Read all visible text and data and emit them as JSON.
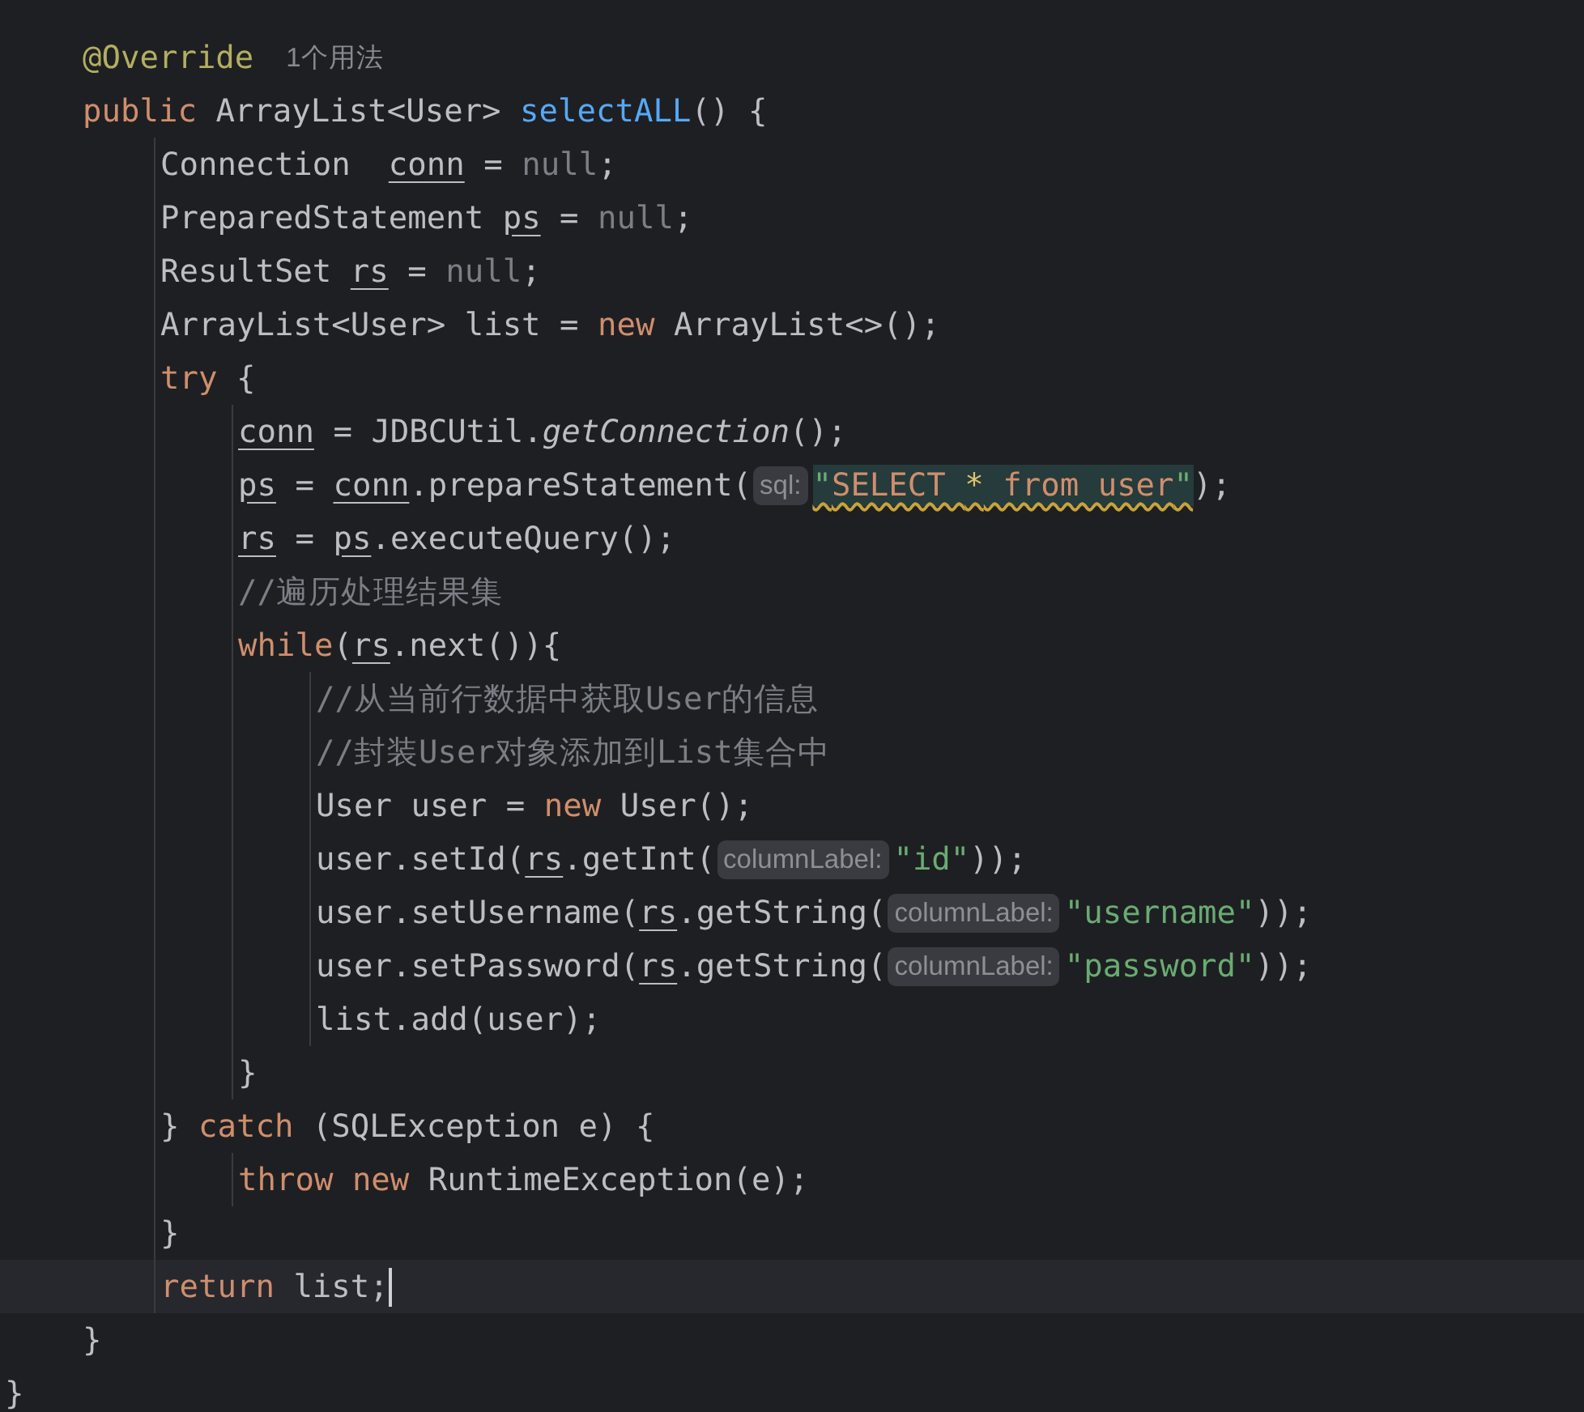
{
  "editor": {
    "class_body": [
      {
        "current": false,
        "tokens": [
          {
            "kind": "annotation",
            "text": "@Override"
          },
          {
            "kind": "usage",
            "text": "1个用法"
          }
        ]
      },
      {
        "current": false,
        "tokens": [
          {
            "kind": "keyword",
            "text": "public"
          },
          {
            "kind": "plain",
            "text": " ArrayList<User> "
          },
          {
            "kind": "method",
            "text": "selectALL"
          },
          {
            "kind": "plain",
            "text": "() {"
          }
        ],
        "children": [
          {
            "current": false,
            "tokens": [
              {
                "kind": "plain",
                "text": "Connection  "
              },
              {
                "kind": "var",
                "text": "conn"
              },
              {
                "kind": "plain",
                "text": " = "
              },
              {
                "kind": "null",
                "text": "null"
              },
              {
                "kind": "plain",
                "text": ";"
              }
            ]
          },
          {
            "current": false,
            "tokens": [
              {
                "kind": "plain",
                "text": "PreparedStatement "
              },
              {
                "kind": "var",
                "text": "ps"
              },
              {
                "kind": "plain",
                "text": " = "
              },
              {
                "kind": "null",
                "text": "null"
              },
              {
                "kind": "plain",
                "text": ";"
              }
            ]
          },
          {
            "current": false,
            "tokens": [
              {
                "kind": "plain",
                "text": "ResultSet "
              },
              {
                "kind": "var",
                "text": "rs"
              },
              {
                "kind": "plain",
                "text": " = "
              },
              {
                "kind": "null",
                "text": "null"
              },
              {
                "kind": "plain",
                "text": ";"
              }
            ]
          },
          {
            "current": false,
            "tokens": [
              {
                "kind": "plain",
                "text": "ArrayList<User> list = "
              },
              {
                "kind": "keyword",
                "text": "new"
              },
              {
                "kind": "plain",
                "text": " ArrayList<>();"
              }
            ]
          },
          {
            "current": false,
            "tokens": [
              {
                "kind": "keyword",
                "text": "try"
              },
              {
                "kind": "plain",
                "text": " {"
              }
            ],
            "children": [
              {
                "current": false,
                "tokens": [
                  {
                    "kind": "var",
                    "text": "conn"
                  },
                  {
                    "kind": "plain",
                    "text": " = JDBCUtil."
                  },
                  {
                    "kind": "static",
                    "text": "getConnection"
                  },
                  {
                    "kind": "plain",
                    "text": "();"
                  }
                ]
              },
              {
                "current": false,
                "tokens": [
                  {
                    "kind": "var",
                    "text": "ps"
                  },
                  {
                    "kind": "plain",
                    "text": " = "
                  },
                  {
                    "kind": "var",
                    "text": "conn"
                  },
                  {
                    "kind": "plain",
                    "text": ".prepareStatement("
                  },
                  {
                    "kind": "hint",
                    "text": "sql:"
                  },
                  {
                    "kind": "sql_quote",
                    "text": "\""
                  },
                  {
                    "kind": "sql_keyword",
                    "text": "SELECT "
                  },
                  {
                    "kind": "sql_op",
                    "text": "*"
                  },
                  {
                    "kind": "sql_keyword",
                    "text": " from user"
                  },
                  {
                    "kind": "sql_quote",
                    "text": "\""
                  },
                  {
                    "kind": "plain",
                    "text": ");"
                  }
                ]
              },
              {
                "current": false,
                "tokens": [
                  {
                    "kind": "var",
                    "text": "rs"
                  },
                  {
                    "kind": "plain",
                    "text": " = "
                  },
                  {
                    "kind": "var",
                    "text": "ps"
                  },
                  {
                    "kind": "plain",
                    "text": ".executeQuery();"
                  }
                ]
              },
              {
                "current": false,
                "tokens": [
                  {
                    "kind": "comment",
                    "text": "//遍历处理结果集"
                  }
                ]
              },
              {
                "current": false,
                "tokens": [
                  {
                    "kind": "keyword",
                    "text": "while"
                  },
                  {
                    "kind": "plain",
                    "text": "("
                  },
                  {
                    "kind": "var",
                    "text": "rs"
                  },
                  {
                    "kind": "plain",
                    "text": ".next()){"
                  }
                ],
                "children": [
                  {
                    "current": false,
                    "tokens": [
                      {
                        "kind": "comment",
                        "text": "//从当前行数据中获取User的信息"
                      }
                    ]
                  },
                  {
                    "current": false,
                    "tokens": [
                      {
                        "kind": "comment",
                        "text": "//封装User对象添加到List集合中"
                      }
                    ]
                  },
                  {
                    "current": false,
                    "tokens": [
                      {
                        "kind": "plain",
                        "text": "User user = "
                      },
                      {
                        "kind": "keyword",
                        "text": "new"
                      },
                      {
                        "kind": "plain",
                        "text": " User();"
                      }
                    ]
                  },
                  {
                    "current": false,
                    "tokens": [
                      {
                        "kind": "plain",
                        "text": "user.setId("
                      },
                      {
                        "kind": "var",
                        "text": "rs"
                      },
                      {
                        "kind": "plain",
                        "text": ".getInt("
                      },
                      {
                        "kind": "hint",
                        "text": "columnLabel:"
                      },
                      {
                        "kind": "string",
                        "text": "\"id\""
                      },
                      {
                        "kind": "plain",
                        "text": "));"
                      }
                    ]
                  },
                  {
                    "current": false,
                    "tokens": [
                      {
                        "kind": "plain",
                        "text": "user.setUsername("
                      },
                      {
                        "kind": "var",
                        "text": "rs"
                      },
                      {
                        "kind": "plain",
                        "text": ".getString("
                      },
                      {
                        "kind": "hint",
                        "text": "columnLabel:"
                      },
                      {
                        "kind": "string",
                        "text": "\"username\""
                      },
                      {
                        "kind": "plain",
                        "text": "));"
                      }
                    ]
                  },
                  {
                    "current": false,
                    "tokens": [
                      {
                        "kind": "plain",
                        "text": "user.setPassword("
                      },
                      {
                        "kind": "var",
                        "text": "rs"
                      },
                      {
                        "kind": "plain",
                        "text": ".getString("
                      },
                      {
                        "kind": "hint",
                        "text": "columnLabel:"
                      },
                      {
                        "kind": "string",
                        "text": "\"password\""
                      },
                      {
                        "kind": "plain",
                        "text": "));"
                      }
                    ]
                  },
                  {
                    "current": false,
                    "tokens": [
                      {
                        "kind": "plain",
                        "text": "list.add(user);"
                      }
                    ]
                  }
                ]
              },
              {
                "current": false,
                "tokens": [
                  {
                    "kind": "plain",
                    "text": "}"
                  }
                ]
              }
            ]
          },
          {
            "current": false,
            "tokens": [
              {
                "kind": "plain",
                "text": "} "
              },
              {
                "kind": "keyword",
                "text": "catch"
              },
              {
                "kind": "plain",
                "text": " (SQLException e) {"
              }
            ],
            "children": [
              {
                "current": false,
                "tokens": [
                  {
                    "kind": "keyword",
                    "text": "throw new"
                  },
                  {
                    "kind": "plain",
                    "text": " RuntimeException(e);"
                  }
                ]
              }
            ]
          },
          {
            "current": false,
            "tokens": [
              {
                "kind": "plain",
                "text": "}"
              }
            ]
          },
          {
            "current": true,
            "tokens": [
              {
                "kind": "keyword",
                "text": "return"
              },
              {
                "kind": "plain",
                "text": " list;"
              }
            ]
          }
        ]
      },
      {
        "current": false,
        "tokens": [
          {
            "kind": "plain",
            "text": "}"
          }
        ]
      }
    ],
    "class_end": {
      "current": false,
      "tokens": [
        {
          "kind": "plain",
          "text": "}"
        }
      ]
    }
  }
}
